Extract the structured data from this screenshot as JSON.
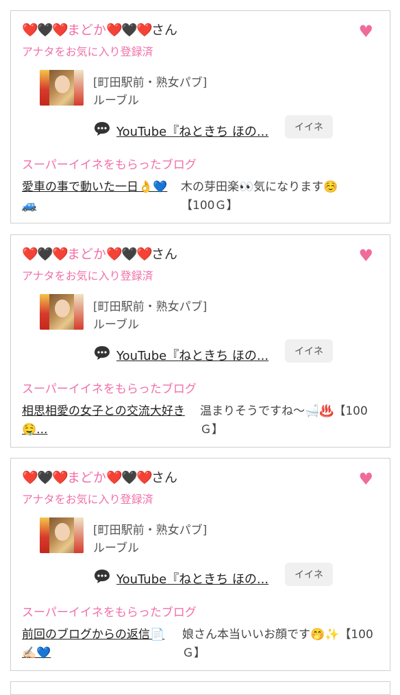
{
  "cards": [
    {
      "hearts_left": [
        "❤️",
        "🖤",
        "❤️"
      ],
      "name": "まどか",
      "hearts_right": [
        "❤️",
        "🖤",
        "❤️"
      ],
      "suffix": "さん",
      "registered": "アナタをお気に入り登録済",
      "shop_name": "[町田駅前・熟女パブ]",
      "shop_sub": "ルーブル",
      "youtube": "YouTube『ねときち ほの...",
      "iine": "イイネ",
      "superlike": "スーパーイイネをもらったブログ",
      "blog_title": "愛車の事で動いた一日👌💙",
      "blog_title_2": "🚙",
      "comment": "木の芽田楽👀気になります☺️【100Ｇ】"
    },
    {
      "hearts_left": [
        "❤️",
        "🖤",
        "❤️"
      ],
      "name": "まどか",
      "hearts_right": [
        "❤️",
        "🖤",
        "❤️"
      ],
      "suffix": "さん",
      "registered": "アナタをお気に入り登録済",
      "shop_name": "[町田駅前・熟女パブ]",
      "shop_sub": "ルーブル",
      "youtube": "YouTube『ねときち ほの...",
      "iine": "イイネ",
      "superlike": "スーパーイイネをもらったブログ",
      "blog_title": "相思相愛の女子との交流大好き",
      "blog_title_2": "🤤...",
      "comment": "温まりそうですね〜🛁♨️【100Ｇ】"
    },
    {
      "hearts_left": [
        "❤️",
        "🖤",
        "❤️"
      ],
      "name": "まどか",
      "hearts_right": [
        "❤️",
        "🖤",
        "❤️"
      ],
      "suffix": "さん",
      "registered": "アナタをお気に入り登録済",
      "shop_name": "[町田駅前・熟女パブ]",
      "shop_sub": "ルーブル",
      "youtube": "YouTube『ねときち ほの...",
      "iine": "イイネ",
      "superlike": "スーパーイイネをもらったブログ",
      "blog_title": "前回のブログからの返信📄",
      "blog_title_2": "✍🏻💙",
      "comment": "娘さん本当いいお顔です🤭✨【100Ｇ】"
    }
  ],
  "icons": {
    "favorite": "heart-icon",
    "comment": "speech-bubble-icon"
  },
  "colors": {
    "accent_pink": "#f070a8",
    "favorite_pink": "#f06b9b",
    "border": "#cfcfcf",
    "button_bg": "#f0f0f0"
  }
}
